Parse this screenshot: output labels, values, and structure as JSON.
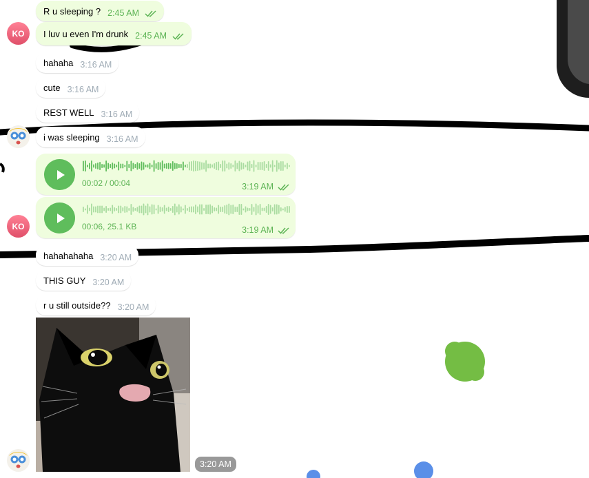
{
  "messages": [
    {
      "text": "R u sleeping ?",
      "time": "2:45 AM",
      "dir": "out",
      "read": true
    },
    {
      "text": "I luv u even I'm drunk",
      "time": "2:45 AM",
      "dir": "out",
      "read": true
    },
    {
      "text": "hahaha",
      "time": "3:16 AM",
      "dir": "in"
    },
    {
      "text": "cute",
      "time": "3:16 AM",
      "dir": "in"
    },
    {
      "text": "REST WELL",
      "time": "3:16 AM",
      "dir": "in"
    },
    {
      "text": "i was sleeping",
      "time": "3:16 AM",
      "dir": "in"
    },
    {
      "text": "hahahahaha",
      "time": "3:20 AM",
      "dir": "in"
    },
    {
      "text": "THIS GUY",
      "time": "3:20 AM",
      "dir": "in"
    },
    {
      "text": "r u still outside??",
      "time": "3:20 AM",
      "dir": "in"
    }
  ],
  "voice_messages": [
    {
      "meta": "00:02 / 00:04",
      "time": "3:19 AM",
      "read": true,
      "progress": 0.5
    },
    {
      "meta": "00:06, 25.1 KB",
      "time": "3:19 AM",
      "read": true,
      "progress": 0
    }
  ],
  "photo": {
    "time": "3:20 AM",
    "subject": "black cat sticking out tongue"
  },
  "avatars": {
    "ko_initials": "KO",
    "other": "cartoon-face-avatar"
  },
  "colors": {
    "outgoing_bubble": "#effdde",
    "incoming_bubble": "#ffffff",
    "outgoing_meta": "#5db455",
    "incoming_meta": "#a0acb6",
    "play_button": "#5fbd5c",
    "avatar_ko": "#e0506a"
  },
  "icons": [
    "double-check-icon",
    "play-icon"
  ]
}
